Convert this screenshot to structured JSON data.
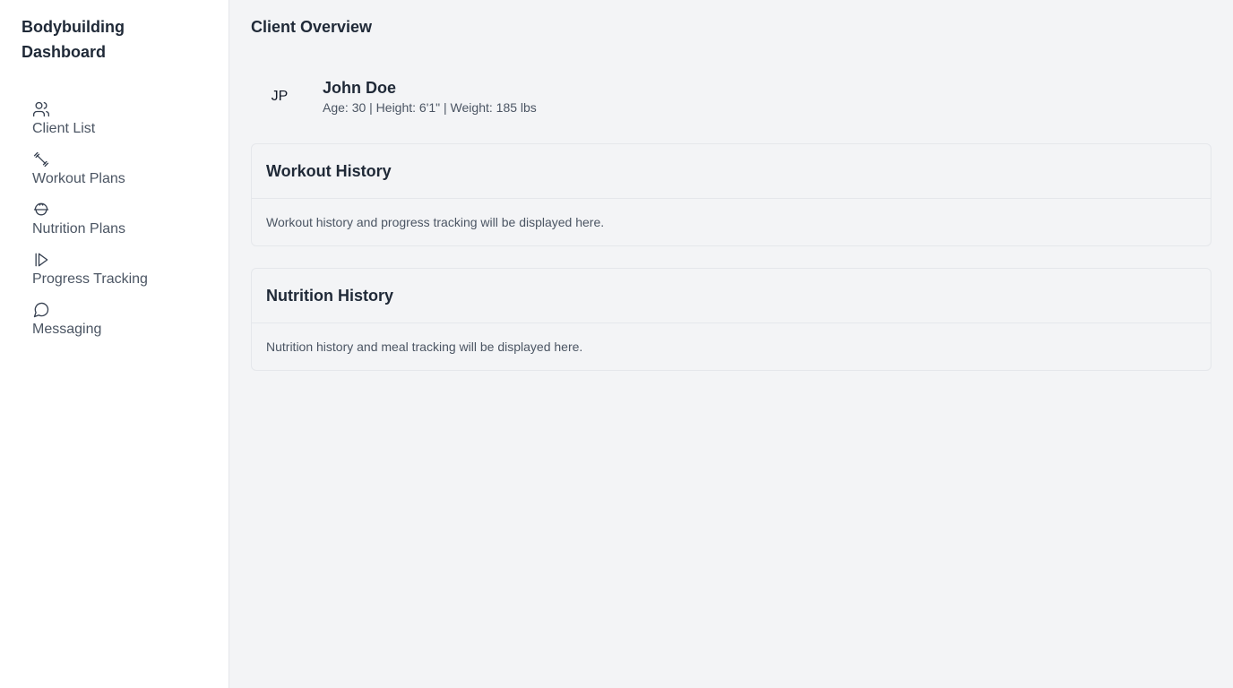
{
  "sidebar": {
    "title": "Bodybuilding Dashboard",
    "items": [
      {
        "label": "Client List",
        "icon": "users-icon"
      },
      {
        "label": "Workout Plans",
        "icon": "dumbbell-icon"
      },
      {
        "label": "Nutrition Plans",
        "icon": "salad-bowl-icon"
      },
      {
        "label": "Progress Tracking",
        "icon": "progress-play-icon"
      },
      {
        "label": "Messaging",
        "icon": "message-circle-icon"
      }
    ]
  },
  "main": {
    "title": "Client Overview",
    "client": {
      "initials": "JP",
      "name": "John Doe",
      "meta": "Age: 30 | Height: 6'1\" | Weight: 185 lbs"
    },
    "cards": [
      {
        "title": "Workout History",
        "body": "Workout history and progress tracking will be displayed here."
      },
      {
        "title": "Nutrition History",
        "body": "Nutrition history and meal tracking will be displayed here."
      }
    ]
  },
  "colors": {
    "sidebar_bg": "#ffffff",
    "main_bg": "#f3f4f6",
    "text_primary": "#1f2937",
    "text_secondary": "#4b5563",
    "border": "#e5e7eb"
  }
}
